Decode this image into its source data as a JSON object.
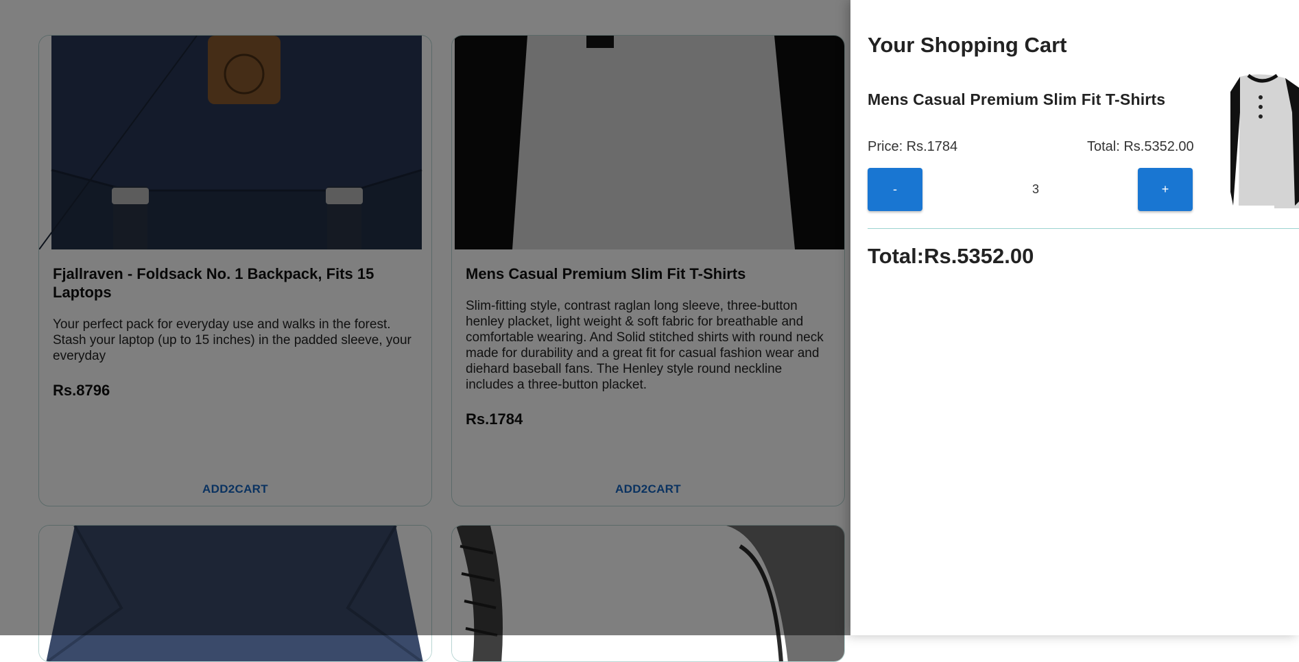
{
  "products": [
    {
      "title": "Fjallraven - Foldsack No. 1 Backpack, Fits 15 Laptops",
      "description": "Your perfect pack for everyday use and walks in the forest. Stash your laptop (up to 15 inches) in the padded sleeve, your everyday",
      "price": "Rs.8796",
      "button": "ADD2CART",
      "image_icon": "backpack-image"
    },
    {
      "title": "Mens Casual Premium Slim Fit T-Shirts",
      "description": "Slim-fitting style, contrast raglan long sleeve, three-button henley placket, light weight & soft fabric for breathable and comfortable wearing. And Solid stitched shirts with round neck made for durability and a great fit for casual fashion wear and diehard baseball fans. The Henley style round neckline includes a three-button placket.",
      "price": "Rs.1784",
      "button": "ADD2CART",
      "image_icon": "tshirt-image"
    },
    {
      "image_icon": "jacket-image"
    },
    {
      "image_icon": "bracelet-image"
    }
  ],
  "cart": {
    "title": "Your Shopping Cart",
    "item": {
      "title": "Mens Casual Premium Slim Fit T-Shirts",
      "price_label": "Price: Rs.1784",
      "total_label": "Total: Rs.5352.00",
      "quantity": "3",
      "minus_label": "-",
      "plus_label": "+",
      "image_icon": "tshirt-thumbnail"
    },
    "grand_total": "Total:Rs.5352.00"
  },
  "colors": {
    "accent": "#1976d2",
    "link": "#1565c0",
    "card_border": "#b7d5d3",
    "backpack": "#223048"
  }
}
